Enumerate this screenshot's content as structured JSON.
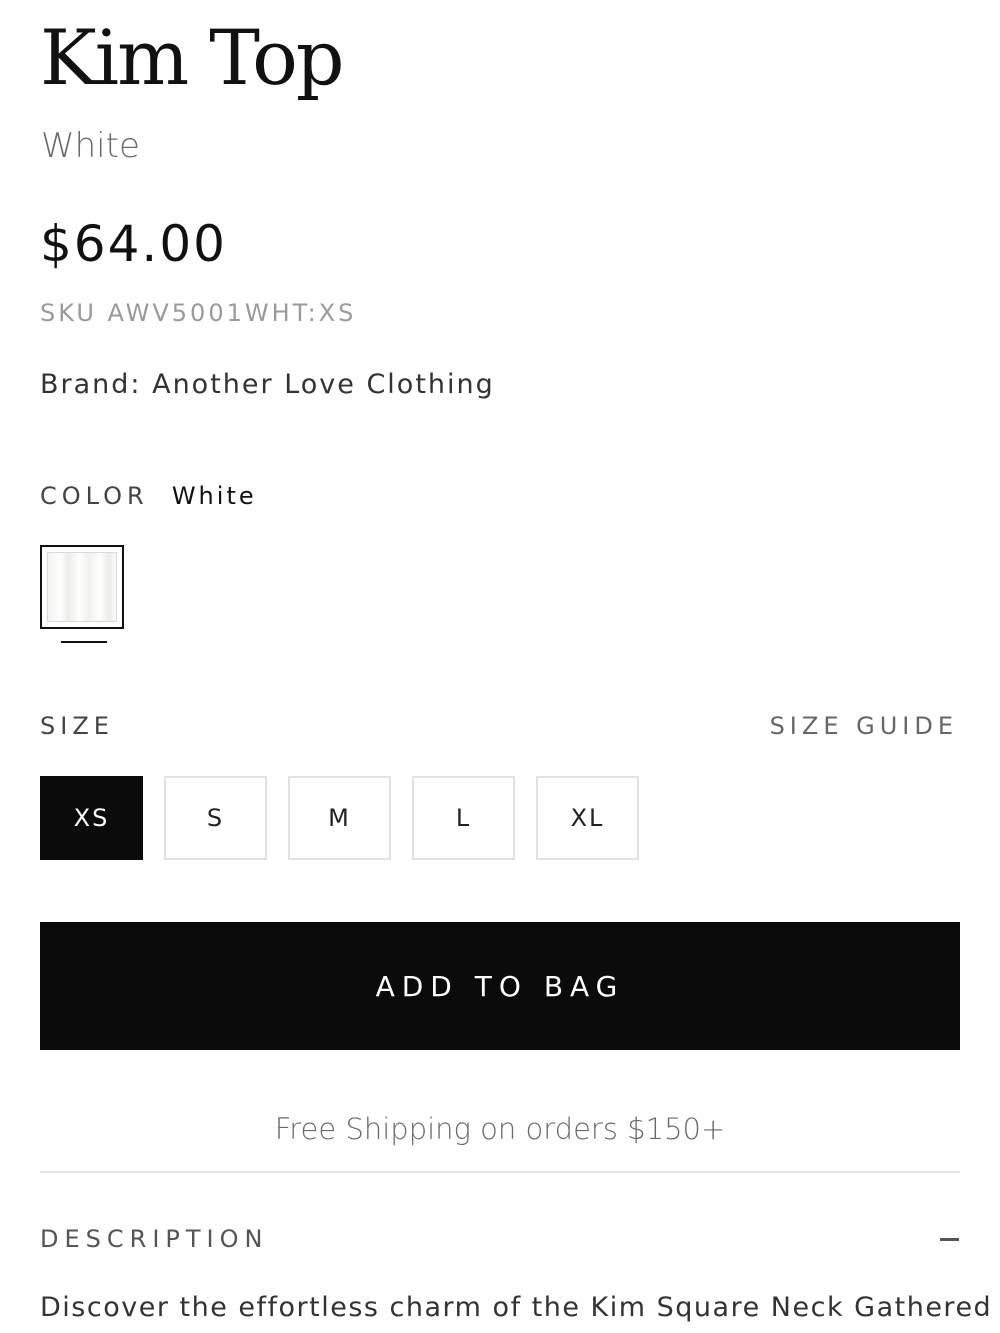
{
  "product": {
    "title": "Kim Top",
    "variant": "White",
    "price": "$64.00",
    "sku": "SKU AWV5001WHT:XS",
    "brand": "Brand: Another Love Clothing"
  },
  "color": {
    "label": "COLOR",
    "selected": "White",
    "swatch_color": "#f5f5f2"
  },
  "size": {
    "label": "SIZE",
    "guide_label": "SIZE GUIDE",
    "options": [
      "XS",
      "S",
      "M",
      "L",
      "XL"
    ],
    "selected": "XS"
  },
  "actions": {
    "add_to_bag": "ADD TO BAG"
  },
  "shipping_note": "Free Shipping on orders $150+",
  "description": {
    "title": "DESCRIPTION",
    "toggle_icon": "minus-icon",
    "text": "Discover the effortless charm of the Kim Square Neck Gathered"
  },
  "colors": {
    "primary": "#0b0b0b",
    "muted_text": "#6a6a6a",
    "border": "#e2e2e2"
  }
}
